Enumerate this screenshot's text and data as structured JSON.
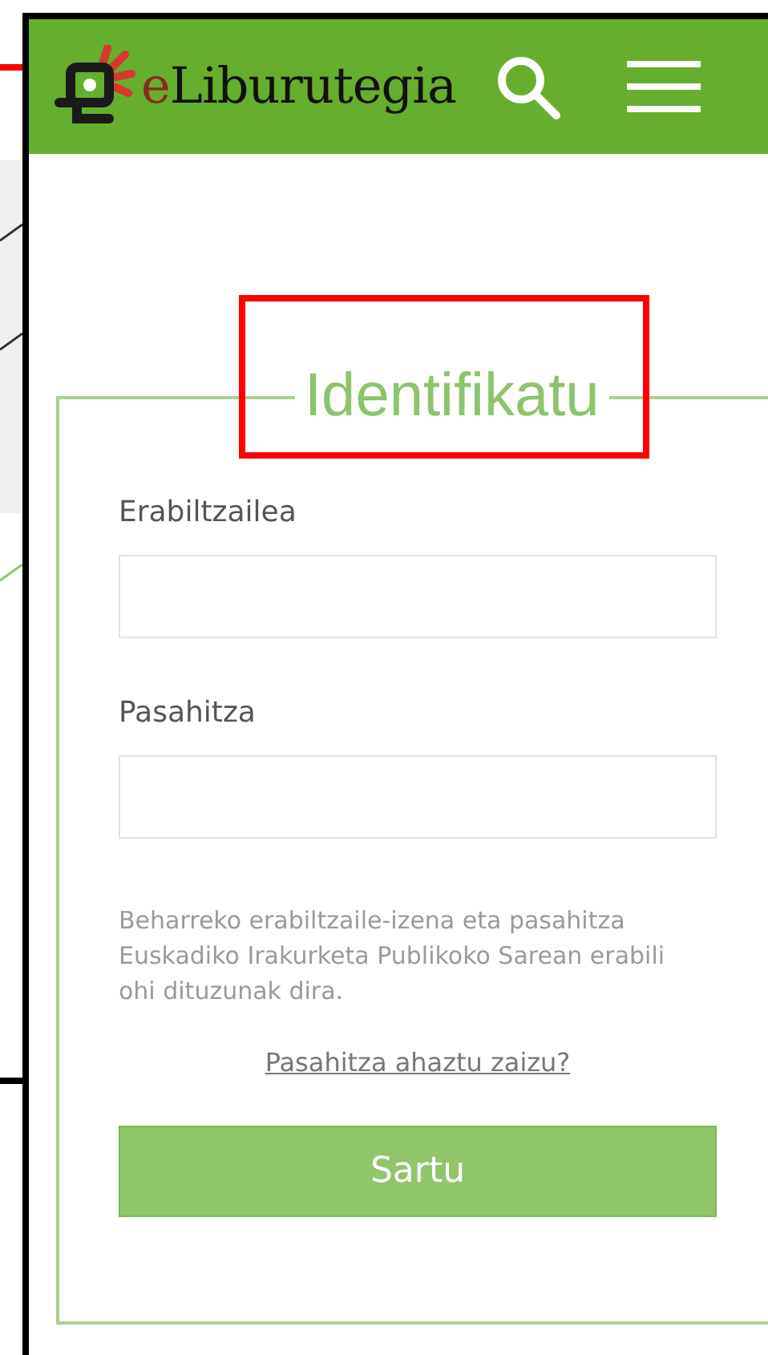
{
  "header": {
    "brand": {
      "accent": "e",
      "text": "Liburutegia"
    }
  },
  "login": {
    "title": "Identifikatu",
    "highlighted": true,
    "fields": [
      {
        "label": "Erabiltzailea"
      },
      {
        "label": "Pasahitza"
      }
    ],
    "hint": "Beharreko erabiltzaile-izena eta pasahitza Euskadiko Irakurketa Publikoko Sarean erabili ohi dituzunak dira.",
    "forgot_link": "Pasahitza ahaztu zaizu?",
    "submit": "Sartu"
  }
}
